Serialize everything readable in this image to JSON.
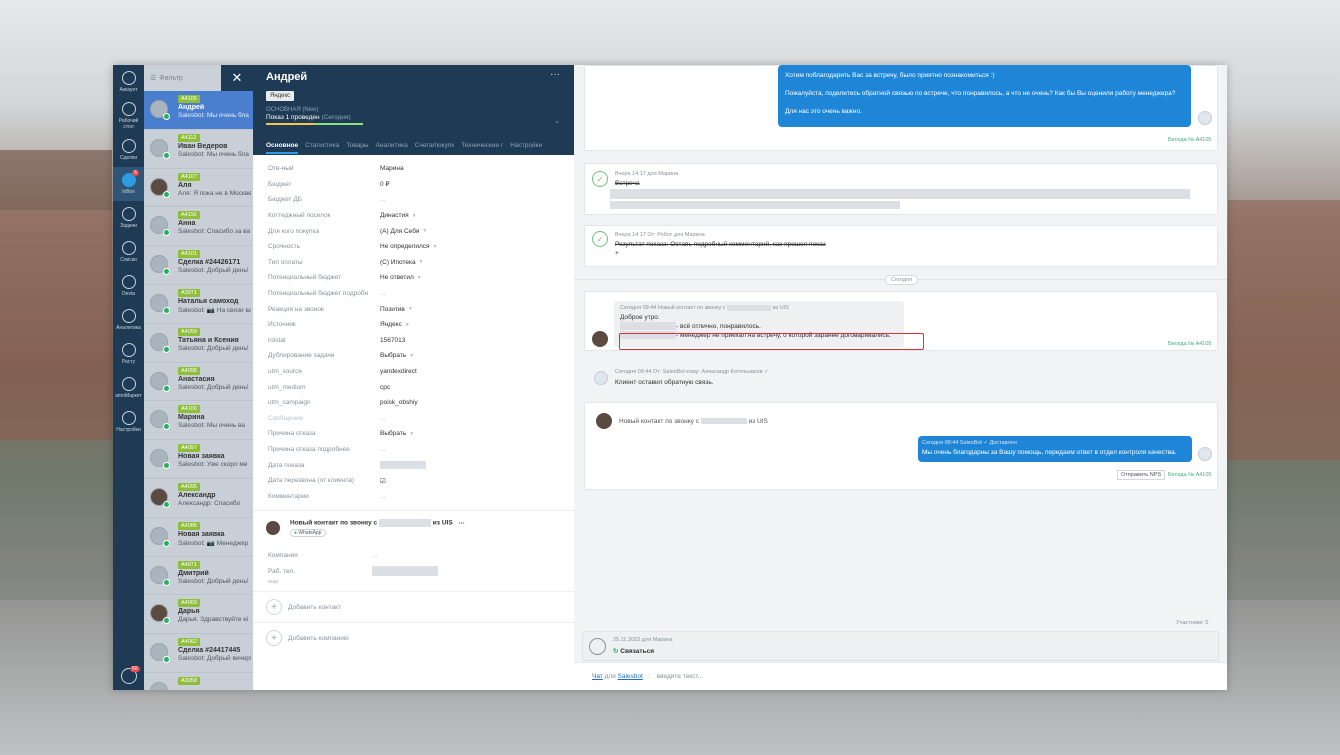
{
  "nav": {
    "items": [
      {
        "icon": "account-icon",
        "label": "Аккаунт"
      },
      {
        "icon": "dashboard-icon",
        "label": "Рабочий стол"
      },
      {
        "icon": "deals-icon",
        "label": "Сделки"
      },
      {
        "icon": "inbox-icon",
        "label": "InBox",
        "badge": "5"
      },
      {
        "icon": "tasks-icon",
        "label": "Задачи"
      },
      {
        "icon": "lists-icon",
        "label": "Списки"
      },
      {
        "icon": "devta-icon",
        "label": "Devta"
      },
      {
        "icon": "analytics-icon",
        "label": "Аналитика"
      },
      {
        "icon": "rasty-icon",
        "label": "Расту"
      },
      {
        "icon": "amomarket-icon",
        "label": "amoМаркет"
      },
      {
        "icon": "settings-icon",
        "label": "Настройки"
      }
    ],
    "bottom_badge": "60"
  },
  "list": {
    "filter_placeholder": "Фильтр",
    "close_label": "✕",
    "items": [
      {
        "tag": "А4105",
        "name": "Андрей",
        "preview": "Salesbot: Мы очень бла",
        "selected": true,
        "photo": false
      },
      {
        "tag": "А4112",
        "name": "Иван Ведеров",
        "preview": "Salesbot: Мы очень бла",
        "photo": false
      },
      {
        "tag": "А4107",
        "name": "Аля",
        "preview": "Аля: Я пока не в Москве",
        "photo": true
      },
      {
        "tag": "А4110",
        "name": "Анна",
        "preview": "Salesbot: Спасибо за ва",
        "photo": false
      },
      {
        "tag": "А4101",
        "name": "Сделка #24426171",
        "preview": "Salesbot: Добрый день!",
        "photo": false
      },
      {
        "tag": "А3971",
        "name": "Наталья самоход",
        "preview": "Salesbot: 📷 На связи ва",
        "photo": false
      },
      {
        "tag": "А4099",
        "name": "Татьяна и Ксения",
        "preview": "Salesbot: Добрый день!",
        "photo": false
      },
      {
        "tag": "А4098",
        "name": "Анастасия",
        "preview": "Salesbot: Добрый день!",
        "photo": false
      },
      {
        "tag": "А4100",
        "name": "Марина",
        "preview": "Salesbot: Мы очень ва",
        "photo": false
      },
      {
        "tag": "А4097",
        "name": "Новая заявка",
        "preview": "Salesbot: Уже скоро ме",
        "photo": false
      },
      {
        "tag": "А4095",
        "name": "Александр",
        "preview": "Александр: Спасибо",
        "photo": true
      },
      {
        "tag": "А4086",
        "name": "Новая заявка",
        "preview": "Salesbot: 📷 Менеджер",
        "photo": false
      },
      {
        "tag": "А4071",
        "name": "Дмитрий",
        "preview": "Salesbot: Добрый день!",
        "photo": false
      },
      {
        "tag": "А4069",
        "name": "Дарья",
        "preview": "Дарья: Здравствуйте ei",
        "photo": true
      },
      {
        "tag": "А4062",
        "name": "Сделка #24417445",
        "preview": "Salesbot: Добрый вечер!",
        "photo": false
      },
      {
        "tag": "А3958",
        "name": "",
        "preview": "",
        "photo": false
      }
    ]
  },
  "card": {
    "title": "Андрей",
    "dots": "···",
    "source_tag": "Яндекс",
    "pipeline": "ОСНОВНАЯ (New)",
    "stage": "Показ 1 проведен",
    "stage_when": "(Сегодня)",
    "tabs": [
      "Основное",
      "Статистика",
      "Товары",
      "Аналитика",
      "Счета/покупк",
      "Технические г",
      "Настройки"
    ],
    "fields": [
      {
        "label": "Отв-ный",
        "value": "Марина"
      },
      {
        "label": "Бюджет",
        "value": "0 ₽"
      },
      {
        "label": "Бюджет ДБ",
        "value": "..."
      },
      {
        "label": "Коттеджный поселок",
        "value": "Династия",
        "chev": true
      },
      {
        "label": "Для кого покупка",
        "value": "(А) Для Себя",
        "chev": true
      },
      {
        "label": "Срочность",
        "value": "Не определился",
        "chev": true
      },
      {
        "label": "Тип оплаты",
        "value": "(С) Ипотека",
        "chev": true
      },
      {
        "label": "Потенциальный бюджет",
        "value": "Не ответил",
        "chev": true
      },
      {
        "label": "Потенциальный бюджет подробн",
        "value": "..."
      },
      {
        "label": "Реакция на звонок",
        "value": "Позитив",
        "chev": true
      },
      {
        "label": "Источник",
        "value": "Яндекс",
        "chev": true
      },
      {
        "label": "roistat",
        "value": "1567013"
      },
      {
        "label": "Дублирование задачи",
        "value": "Выбрать",
        "chev": true
      },
      {
        "label": "utm_source",
        "value": "yandexdirect"
      },
      {
        "label": "utm_medium",
        "value": "cpc"
      },
      {
        "label": "utm_campaign",
        "value": "poisk_obshiy"
      },
      {
        "label": "Сообщение",
        "value": "...",
        "faded": true
      },
      {
        "label": "Причина отказа",
        "value": "Выбрать",
        "chev": true
      },
      {
        "label": "Причина отказа подробнее",
        "value": "..."
      },
      {
        "label": "Дата показа",
        "value": "",
        "blur": true
      },
      {
        "label": "Дата перезвона (от клиента)",
        "value": "☑"
      },
      {
        "label": "Комментарии",
        "value": "..."
      }
    ],
    "contact_title": "Новый контакт по звонку с",
    "contact_from": "из UIS",
    "contact_dots": "···",
    "contact_chip": "WhatsApp",
    "contact_rows": [
      {
        "label": "Компания",
        "value": "..."
      },
      {
        "label": "Раб. тел.",
        "value": ""
      }
    ],
    "contact_more": "еще",
    "add_contact": "Добавить контакт",
    "add_company": "Добавить компанию"
  },
  "feed": {
    "out1_l1": "Хотим поблагодарить Вас за встречу, было приятно познакомиться :)",
    "out1_l2": "Пожалуйста, поделитесь обратной связью по встрече, что понравилось, а что не очень? Как бы Вы оценили работу менеджера?",
    "out1_l3": "Для нас это очень важно.",
    "beseda": "Беседа № А4105",
    "ev1_meta": "Вчера 14:17  для Марина",
    "ev1_title": "Встреча",
    "ev2_meta": "Вчера 14:17  От: Робот для Марина",
    "ev2_title": "Результат показа: Оставь подробный комментарий, как прошел показ",
    "ev2_body": "+",
    "today": "Сегодня",
    "in_meta": "Сегодня 09:44 Новый контакт по звонку с",
    "in_meta_from": "из UIS",
    "in_l1": "Доброе утро.",
    "in_l2": "- всё отлично, понравилось.",
    "in_l3": "- менеджер не приехал на встречу, о которой заранее договаривались.",
    "sys_meta": "Сегодня 09:44 От: SalesBot кому: Александр Котельников ✓",
    "sys_text": "Клиент оставил обратную связь.",
    "contact_line": "Новый контакт по звонку с",
    "contact_line_from": "из UIS",
    "out2_meta": "Сегодня 09:44 SalesBot  ✓ Доставлен",
    "out2_text": "Мы очень благодарны за Вашу помощь, передаем ответ в отдел контроля качества.",
    "nps_button": "Отправить NPS",
    "participants": "Участники: 0",
    "task_meta": "25.11.2023 для Марина",
    "task_title": "Связаться",
    "input_chat": "Чат",
    "input_for": "для",
    "input_bot": "Salesbot",
    "input_placeholder": "введите текст..."
  },
  "colors": {
    "nav": "#1e3a54",
    "accent": "#1f86d7",
    "tag": "#8fbf3a",
    "alert": "#d9303a"
  }
}
